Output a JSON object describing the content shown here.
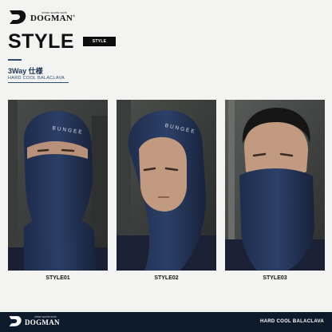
{
  "brand": {
    "tagline": "urban sports work",
    "name": "DOGMAN",
    "registered_mark": "®",
    "logo_icon": "dogman-logo-icon"
  },
  "header": {
    "title": "STYLE",
    "badge": "STYLE",
    "subtitle": "3Way 仕様",
    "product": "HARD COOL BALACLAVA"
  },
  "photo_text": "BUNGEE",
  "styles": [
    {
      "label": "STYLE01"
    },
    {
      "label": "STYLE02"
    },
    {
      "label": "STYLE03"
    }
  ],
  "footer": {
    "tagline": "urban sports work",
    "name": "DOGMAN",
    "product": "HARD COOL BALACLAVA"
  },
  "colors": {
    "navy": "#1c2a3e",
    "accent": "#2e4e72",
    "footer_bg": "#0d1a2c",
    "badge_bg": "#0c0c0c"
  }
}
